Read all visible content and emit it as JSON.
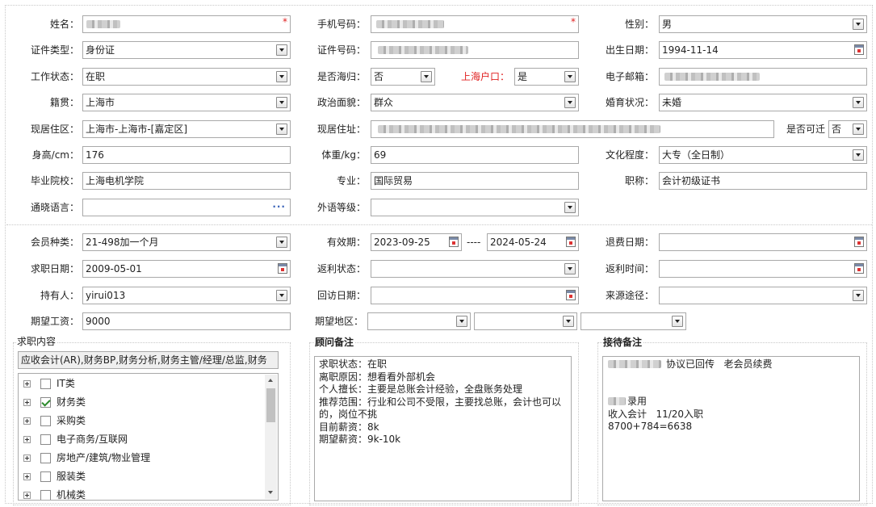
{
  "personal": {
    "name_label": "姓名：",
    "phone_label": "手机号码：",
    "gender_label": "性别：",
    "gender_value": "男",
    "id_type_label": "证件类型：",
    "id_type_value": "身份证",
    "id_no_label": "证件号码：",
    "birth_label": "出生日期：",
    "birth_value": "1994-11-14",
    "work_status_label": "工作状态：",
    "work_status_value": "在职",
    "overseas_label": "是否海归：",
    "overseas_value": "否",
    "shanghai_hukou_label": "上海户口：",
    "shanghai_hukou_value": "是",
    "email_label": "电子邮箱：",
    "native_label": "籍贯：",
    "native_value": "上海市",
    "political_label": "政治面貌：",
    "political_value": "群众",
    "marital_label": "婚育状况：",
    "marital_value": "未婚",
    "residence_area_label": "现居住区：",
    "residence_area_value": " 上海市-上海市-[嘉定区]",
    "address_label": "现居住址：",
    "relocate_label": "是否可迁",
    "relocate_value": "否",
    "height_label": "身高/cm：",
    "height_value": "176",
    "weight_label": "体重/kg：",
    "weight_value": "69",
    "education_label": "文化程度：",
    "education_value": "大专（全日制）",
    "school_label": "毕业院校：",
    "school_value": "上海电机学院",
    "major_label": "专业：",
    "major_value": "国际贸易",
    "title_label": "职称：",
    "title_value": "会计初级证书",
    "language_label": "通晓语言：",
    "language_btn": "···",
    "foreign_level_label": "外语等级："
  },
  "membership": {
    "type_label": "会员种类：",
    "type_value": " 21-498加一个月",
    "validity_label": "有效期：",
    "validity_start": "2023-09-25",
    "validity_sep": "----",
    "validity_end": "2024-05-24",
    "refund_date_label": "退费日期：",
    "job_date_label": "求职日期：",
    "job_date_value": "2009-05-01",
    "rebate_status_label": "返利状态：",
    "rebate_time_label": "返利时间：",
    "holder_label": "持有人：",
    "holder_value": "yirui013",
    "visit_date_label": "回访日期：",
    "source_label": "来源途径：",
    "salary_label": "期望工资：",
    "salary_value": "9000",
    "region_label": "期望地区："
  },
  "job_content": {
    "title": "求职内容",
    "selected": "应收会计(AR),财务BP,财务分析,财务主管/经理/总监,财务",
    "items": [
      {
        "name": "IT类",
        "checked": false
      },
      {
        "name": "财务类",
        "checked": true
      },
      {
        "name": "采购类",
        "checked": false
      },
      {
        "name": "电子商务/互联网",
        "checked": false
      },
      {
        "name": "房地产/建筑/物业管理",
        "checked": false
      },
      {
        "name": "服装类",
        "checked": false
      },
      {
        "name": "机械类",
        "checked": false
      }
    ]
  },
  "advisor_notes": {
    "title": "顾问备注",
    "text": "求职状态：在职\n离职原因：想看看外部机会\n个人擅长：主要是总账会计经验，全盘账务处理\n推荐范围：行业和公司不受限，主要找总账，会计也可以的，岗位不挑\n目前薪资：8k\n期望薪资：9k-10k"
  },
  "reception_notes": {
    "title": "接待备注",
    "line1": "协议已回传   老会员续费",
    "line2": "录用",
    "line3": "收入会计   11/20入职",
    "line4": "8700+784=6638"
  },
  "colors": {
    "required": "#e01f1f",
    "hukou_label": "#e01f1f",
    "border": "#a9a9a9"
  }
}
